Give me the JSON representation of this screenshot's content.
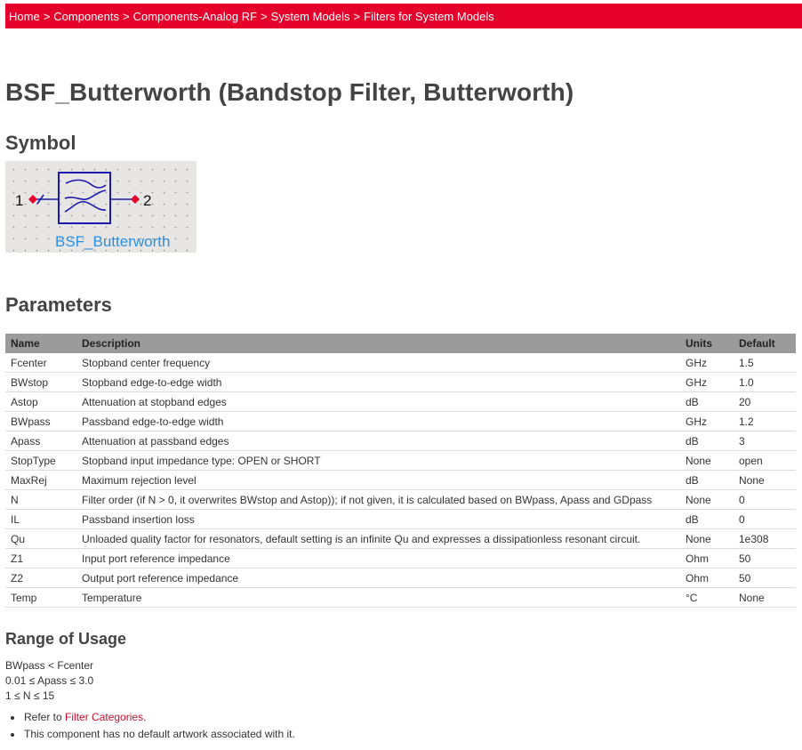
{
  "breadcrumb": {
    "items": [
      "Home",
      "Components",
      "Components-Analog RF",
      "System Models",
      "Filters for System Models"
    ],
    "separator": ">"
  },
  "page_title": "BSF_Butterworth (Bandstop Filter, Butterworth)",
  "symbol": {
    "heading": "Symbol",
    "port1_label": "1",
    "port2_label": "2",
    "component_label": "BSF_Butterworth",
    "line_color": "#1a1aaa",
    "pin_color": "#e4002b",
    "label_color": "#2a8fe0"
  },
  "parameters": {
    "heading": "Parameters",
    "columns": [
      "Name",
      "Description",
      "Units",
      "Default"
    ],
    "rows": [
      [
        "Fcenter",
        "Stopband center frequency",
        "GHz",
        "1.5"
      ],
      [
        "BWstop",
        "Stopband edge-to-edge width",
        "GHz",
        "1.0"
      ],
      [
        "Astop",
        "Attenuation at stopband edges",
        "dB",
        "20"
      ],
      [
        "BWpass",
        "Passband edge-to-edge width",
        "GHz",
        "1.2"
      ],
      [
        "Apass",
        "Attenuation at passband edges",
        "dB",
        "3"
      ],
      [
        "StopType",
        "Stopband input impedance type: OPEN or SHORT",
        "None",
        "open"
      ],
      [
        "MaxRej",
        "Maximum rejection level",
        "dB",
        "None"
      ],
      [
        "N",
        "Filter order (if N > 0, it overwrites BWstop and Astop)); if not given, it is calculated based on BWpass, Apass and GDpass",
        "None",
        "0"
      ],
      [
        "IL",
        "Passband insertion loss",
        "dB",
        "0"
      ],
      [
        "Qu",
        "Unloaded quality factor for resonators, default setting is an infinite Qu and expresses a dissipationless resonant circuit.",
        "None",
        "1e308"
      ],
      [
        "Z1",
        "Input port reference impedance",
        "Ohm",
        "50"
      ],
      [
        "Z2",
        "Output port reference impedance",
        "Ohm",
        "50"
      ],
      [
        "Temp",
        "Temperature",
        "°C",
        "None"
      ]
    ]
  },
  "range_of_usage": {
    "heading": "Range of Usage",
    "lines": [
      "BWpass < Fcenter",
      "0.01 ≤ Apass ≤ 3.0",
      "1 ≤ N ≤ 15"
    ]
  },
  "notes": {
    "refer_prefix": "Refer to ",
    "refer_link": "Filter Categories",
    "refer_suffix": ".",
    "artwork_note": "This component has no default artwork associated with it."
  }
}
